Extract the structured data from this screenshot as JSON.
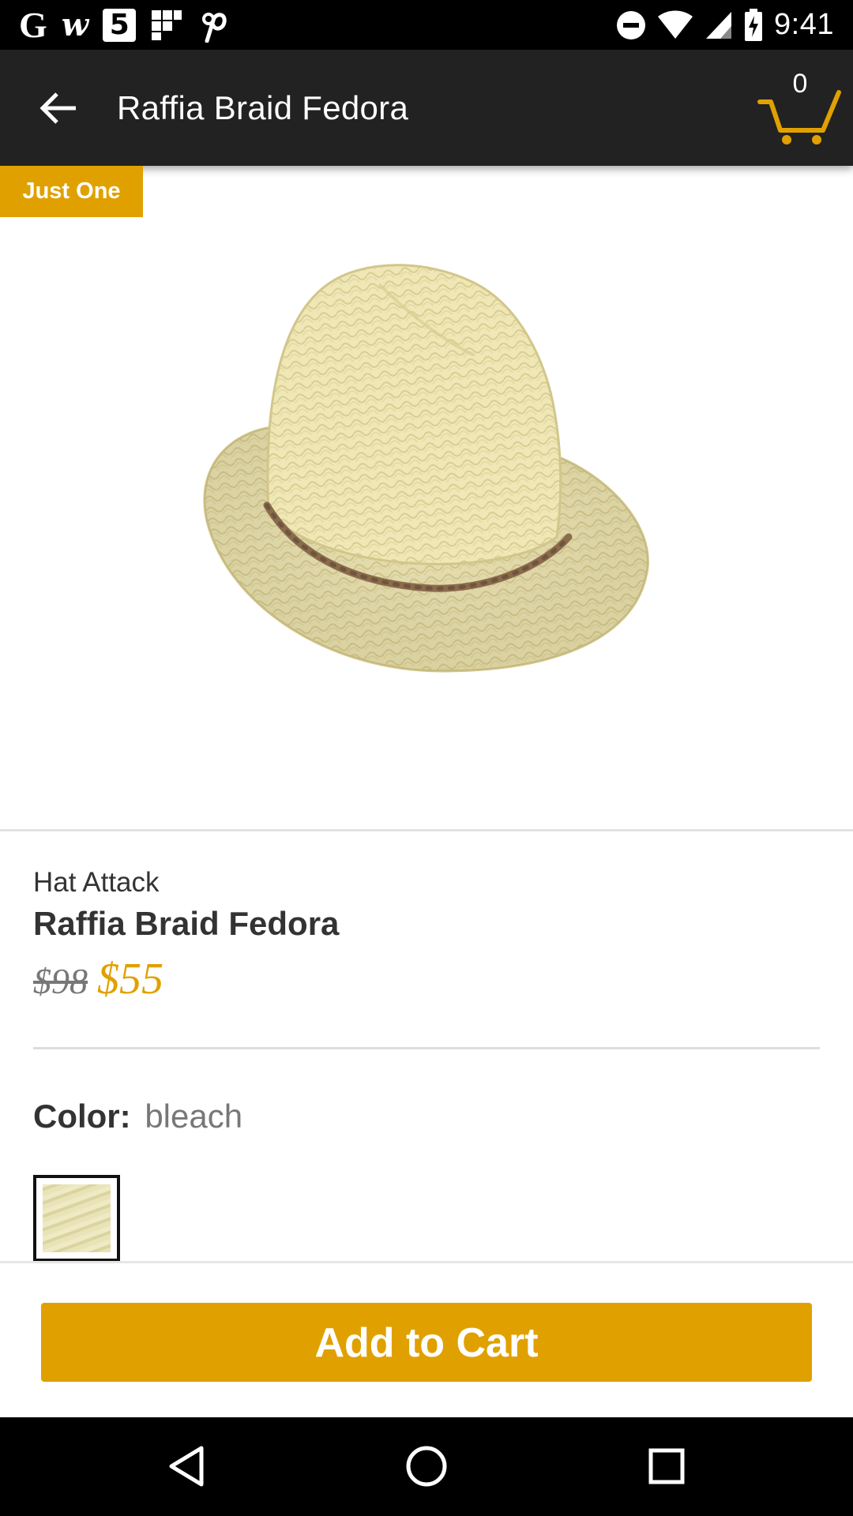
{
  "status_bar": {
    "time": "9:41",
    "left_icons": [
      "google-icon",
      "wattpad-icon",
      "channel5-icon",
      "flipboard-icon",
      "pinterest-icon"
    ],
    "right_icons": [
      "do-not-disturb-icon",
      "wifi-icon",
      "cell-signal-icon",
      "battery-charging-icon"
    ],
    "g_glyph": "G",
    "w_glyph": "w",
    "five_glyph": "5"
  },
  "app_bar": {
    "title": "Raffia Braid Fedora",
    "cart_count": "0",
    "icons": [
      "back-arrow-icon",
      "cart-icon"
    ]
  },
  "badge": {
    "label": "Just One"
  },
  "product": {
    "brand": "Hat Attack",
    "name": "Raffia Braid Fedora",
    "original_price": "$98",
    "sale_price": "$55",
    "color_label": "Color:",
    "color_value": "bleach"
  },
  "actions": {
    "add_to_cart_label": "Add to Cart"
  },
  "nav_bar": {
    "icons": [
      "back-triangle-icon",
      "home-circle-icon",
      "recents-square-icon"
    ]
  },
  "colors": {
    "accent": "#e0a100",
    "app_bar": "#222222",
    "status_bar": "#000000",
    "text_dark": "#333333",
    "text_muted": "#777777"
  }
}
